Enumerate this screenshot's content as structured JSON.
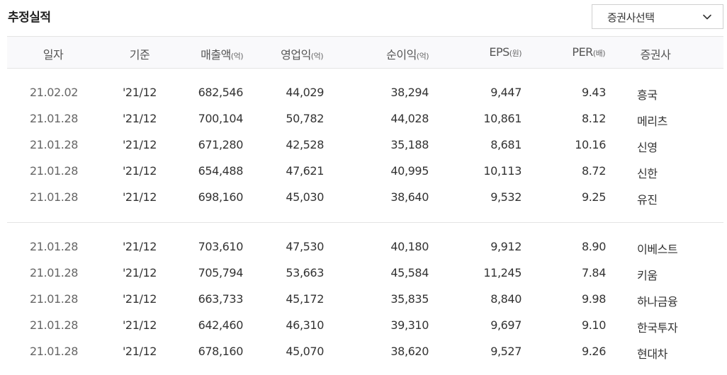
{
  "title": "추정실적",
  "broker_select": {
    "label": "증권사선택",
    "icon": "chevron-down-icon"
  },
  "columns": {
    "date": "일자",
    "basis": "기준",
    "sales": "매출액",
    "sales_unit": "(억)",
    "op_income": "영업익",
    "op_income_unit": "(억)",
    "net_income": "순이익",
    "net_income_unit": "(억)",
    "eps": "EPS",
    "eps_unit": "(원)",
    "per": "PER",
    "per_unit": "(배)",
    "broker": "증권사"
  },
  "rows": [
    {
      "date": "21.02.02",
      "basis": "'21/12",
      "sales": "682,546",
      "op_income": "44,029",
      "net_income": "38,294",
      "eps": "9,447",
      "per": "9.43",
      "broker": "흥국"
    },
    {
      "date": "21.01.28",
      "basis": "'21/12",
      "sales": "700,104",
      "op_income": "50,782",
      "net_income": "44,028",
      "eps": "10,861",
      "per": "8.12",
      "broker": "메리츠"
    },
    {
      "date": "21.01.28",
      "basis": "'21/12",
      "sales": "671,280",
      "op_income": "42,528",
      "net_income": "35,188",
      "eps": "8,681",
      "per": "10.16",
      "broker": "신영"
    },
    {
      "date": "21.01.28",
      "basis": "'21/12",
      "sales": "654,488",
      "op_income": "47,621",
      "net_income": "40,995",
      "eps": "10,113",
      "per": "8.72",
      "broker": "신한"
    },
    {
      "date": "21.01.28",
      "basis": "'21/12",
      "sales": "698,160",
      "op_income": "45,030",
      "net_income": "38,640",
      "eps": "9,532",
      "per": "9.25",
      "broker": "유진"
    },
    {
      "date": "21.01.28",
      "basis": "'21/12",
      "sales": "703,610",
      "op_income": "47,530",
      "net_income": "40,180",
      "eps": "9,912",
      "per": "8.90",
      "broker": "이베스트"
    },
    {
      "date": "21.01.28",
      "basis": "'21/12",
      "sales": "705,794",
      "op_income": "53,663",
      "net_income": "45,584",
      "eps": "11,245",
      "per": "7.84",
      "broker": "키움"
    },
    {
      "date": "21.01.28",
      "basis": "'21/12",
      "sales": "663,733",
      "op_income": "45,172",
      "net_income": "35,835",
      "eps": "8,840",
      "per": "9.98",
      "broker": "하나금융"
    },
    {
      "date": "21.01.28",
      "basis": "'21/12",
      "sales": "642,460",
      "op_income": "46,310",
      "net_income": "39,310",
      "eps": "9,697",
      "per": "9.10",
      "broker": "한국투자"
    },
    {
      "date": "21.01.28",
      "basis": "'21/12",
      "sales": "678,160",
      "op_income": "45,070",
      "net_income": "38,620",
      "eps": "9,527",
      "per": "9.26",
      "broker": "현대차"
    }
  ]
}
